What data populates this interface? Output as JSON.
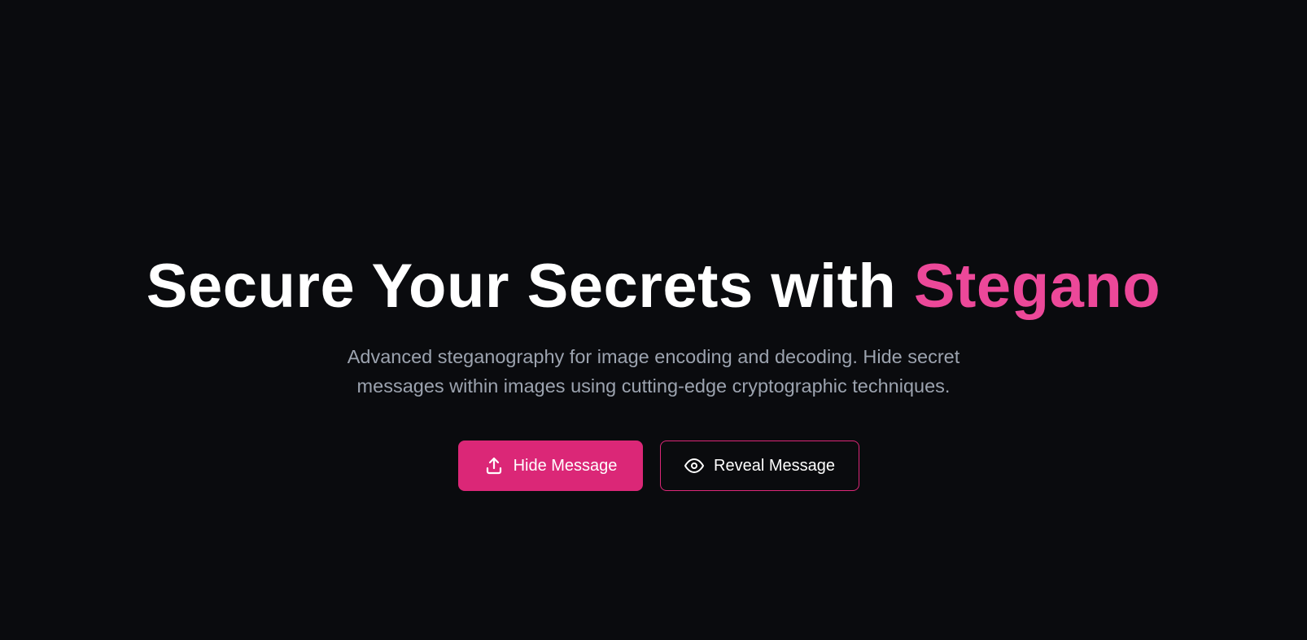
{
  "hero": {
    "title_main": "Secure Your Secrets with ",
    "title_accent": "Stegano",
    "subtitle": "Advanced steganography for image encoding and decoding. Hide secret messages within images using cutting-edge cryptographic techniques."
  },
  "actions": {
    "hide": {
      "label": "Hide Message",
      "icon": "upload-icon"
    },
    "reveal": {
      "label": "Reveal Message",
      "icon": "eye-icon"
    }
  },
  "colors": {
    "background": "#0a0b0e",
    "accent": "#ec4899",
    "primary_button": "#db2777",
    "subtitle_text": "#9ca3af"
  }
}
